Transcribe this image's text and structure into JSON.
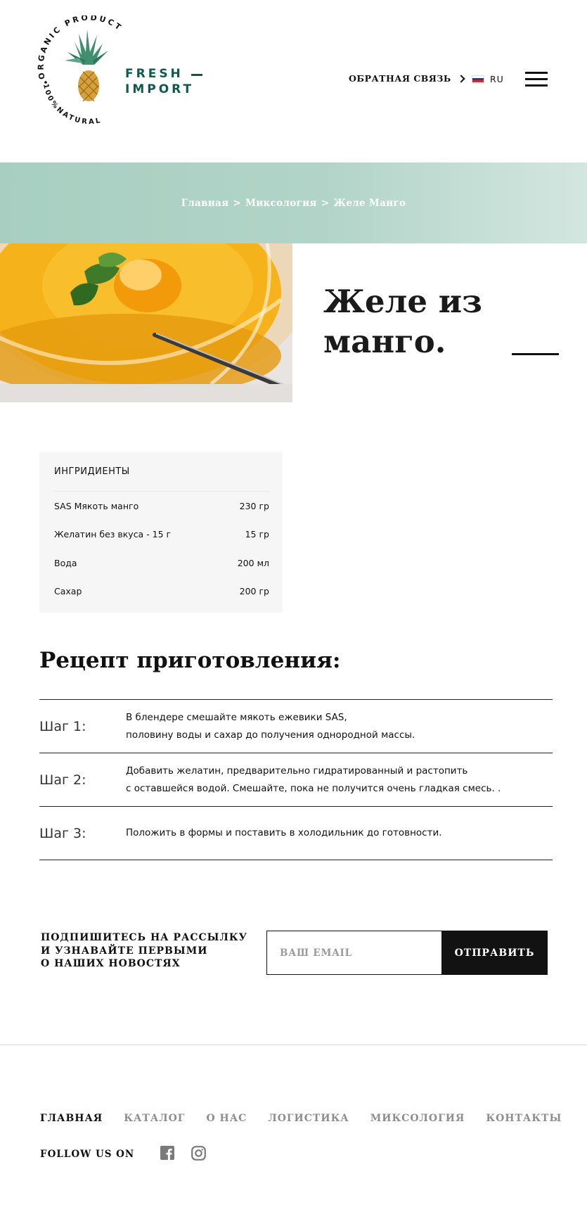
{
  "header": {
    "logo": {
      "arc_top": "ORGANIC PRODUCT",
      "arc_bottom": "100%NATURAL",
      "word1": "FRESH",
      "word2": "IMPORT"
    },
    "feedback_label": "ОБРАТНАЯ СВЯЗЬ",
    "lang_label": "RU",
    "icons": {
      "chevron": "chevron-right-icon",
      "flag": "russia-flag-icon",
      "menu": "hamburger-menu-icon"
    }
  },
  "breadcrumb": {
    "items": [
      "Главная",
      "Миксология",
      "Желе Манго"
    ],
    "separator": ">"
  },
  "hero": {
    "title_line1": "Желе из",
    "title_line2": "манго.",
    "image": "mango-jelly-photo"
  },
  "ingredients": {
    "title": "ИНГРИДИЕНТЫ",
    "rows": [
      {
        "name": "SAS Мякоть манго",
        "amount": "230 гр"
      },
      {
        "name": "Желатин без вкуса - 15 г",
        "amount": "15 гр"
      },
      {
        "name": "Вода",
        "amount": "200 мл"
      },
      {
        "name": "Сахар",
        "amount": "200 гр"
      }
    ]
  },
  "recipe": {
    "title": "Рецепт приготовления:",
    "steps": [
      {
        "label": "Шаг 1:",
        "line1": "В блендере смешайте мякоть ежевики SAS,",
        "line2": "половину воды и сахар до получения однородной массы."
      },
      {
        "label": "Шаг 2:",
        "line1": "Добавить желатин, предварительно гидратированный и растопить",
        "line2": "с оставшейся водой. Смешайте, пока не получится очень гладкая смесь. ."
      },
      {
        "label": "Шаг 3:",
        "line1": "Положить в формы и поставить в холодильник до готовности.",
        "line2": ""
      }
    ]
  },
  "subscribe": {
    "line1": "ПОДПИШИТЕСЬ НА РАССЫЛКУ",
    "line2": "И УЗНАВАЙТЕ ПЕРВЫМИ",
    "line3": "О НАШИХ НОВОСТЯХ",
    "email_placeholder": "ВАШ EMAIL",
    "button_label": "ОТПРАВИТЬ"
  },
  "footer": {
    "nav": [
      "ГЛАВНАЯ",
      "КАТАЛОГ",
      "О НАС",
      "ЛОГИСТИКА",
      "МИКСОЛОГИЯ",
      "КОНТАКТЫ"
    ],
    "follow_label": "FOLLOW US ON",
    "social_icons": [
      "facebook-icon",
      "instagram-icon"
    ]
  },
  "colors": {
    "brand_green": "#0f5a4e",
    "banner_gradient_start": "#a7cfc1",
    "banner_gradient_end": "#d3e6e0",
    "button_dark": "#121212",
    "nav_muted": "#8e8e8e"
  }
}
